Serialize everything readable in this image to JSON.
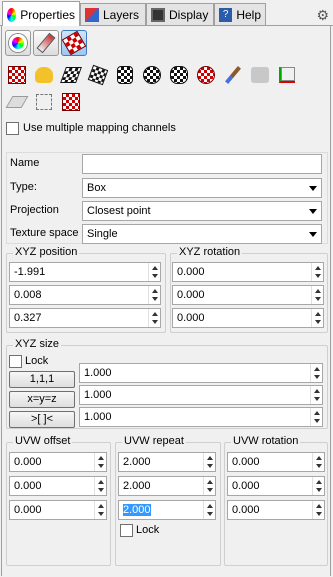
{
  "tabs": [
    {
      "label": "Properties"
    },
    {
      "label": "Layers"
    },
    {
      "label": "Display"
    },
    {
      "label": "Help"
    }
  ],
  "options": {
    "multiple_channels_label": "Use multiple mapping channels"
  },
  "fields": {
    "name_label": "Name",
    "name_value": "",
    "type_label": "Type:",
    "type_value": "Box",
    "projection_label": "Projection",
    "projection_value": "Closest point",
    "texture_space_label": "Texture space",
    "texture_space_value": "Single"
  },
  "xyz_position": {
    "title": "XYZ position",
    "values": [
      "-1.991",
      "0.008",
      "0.327"
    ]
  },
  "xyz_rotation": {
    "title": "XYZ rotation",
    "values": [
      "0.000",
      "0.000",
      "0.000"
    ]
  },
  "xyz_size": {
    "title": "XYZ size",
    "lock_label": "Lock",
    "buttons": [
      "1,1,1",
      "x=y=z",
      ">[ ]<"
    ],
    "values": [
      "1.000",
      "1.000",
      "1.000"
    ]
  },
  "uvw_offset": {
    "title": "UVW offset",
    "values": [
      "0.000",
      "0.000",
      "0.000"
    ]
  },
  "uvw_repeat": {
    "title": "UVW repeat",
    "values": [
      "2.000",
      "2.000",
      "2.000"
    ],
    "lock_label": "Lock"
  },
  "uvw_rotation": {
    "title": "UVW rotation",
    "values": [
      "0.000",
      "0.000",
      "0.000"
    ]
  },
  "colors": {
    "selection": "#3399ff",
    "active_tab": "#ffffff"
  }
}
